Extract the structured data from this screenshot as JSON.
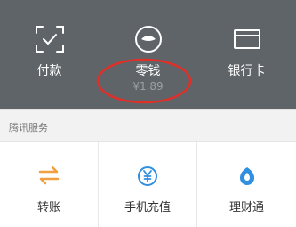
{
  "header": {
    "items": [
      {
        "label": "付款",
        "icon": "scan-pay-icon"
      },
      {
        "label": "零钱",
        "sub": "¥1.89",
        "icon": "change-wallet-icon"
      },
      {
        "label": "银行卡",
        "icon": "bank-card-icon"
      }
    ]
  },
  "services": {
    "title": "腾讯服务",
    "items": [
      {
        "label": "转账",
        "icon": "transfer-arrows-icon",
        "color": "#f0a040"
      },
      {
        "label": "手机充值",
        "icon": "yuan-circle-icon",
        "color": "#2f8fe0"
      },
      {
        "label": "理财通",
        "icon": "wealth-drop-icon",
        "color": "#2f8fe0"
      }
    ]
  },
  "colors": {
    "header_bg": "#5f6468",
    "section_bg": "#f2f2f2",
    "annotation_circle": "#e0302a"
  }
}
